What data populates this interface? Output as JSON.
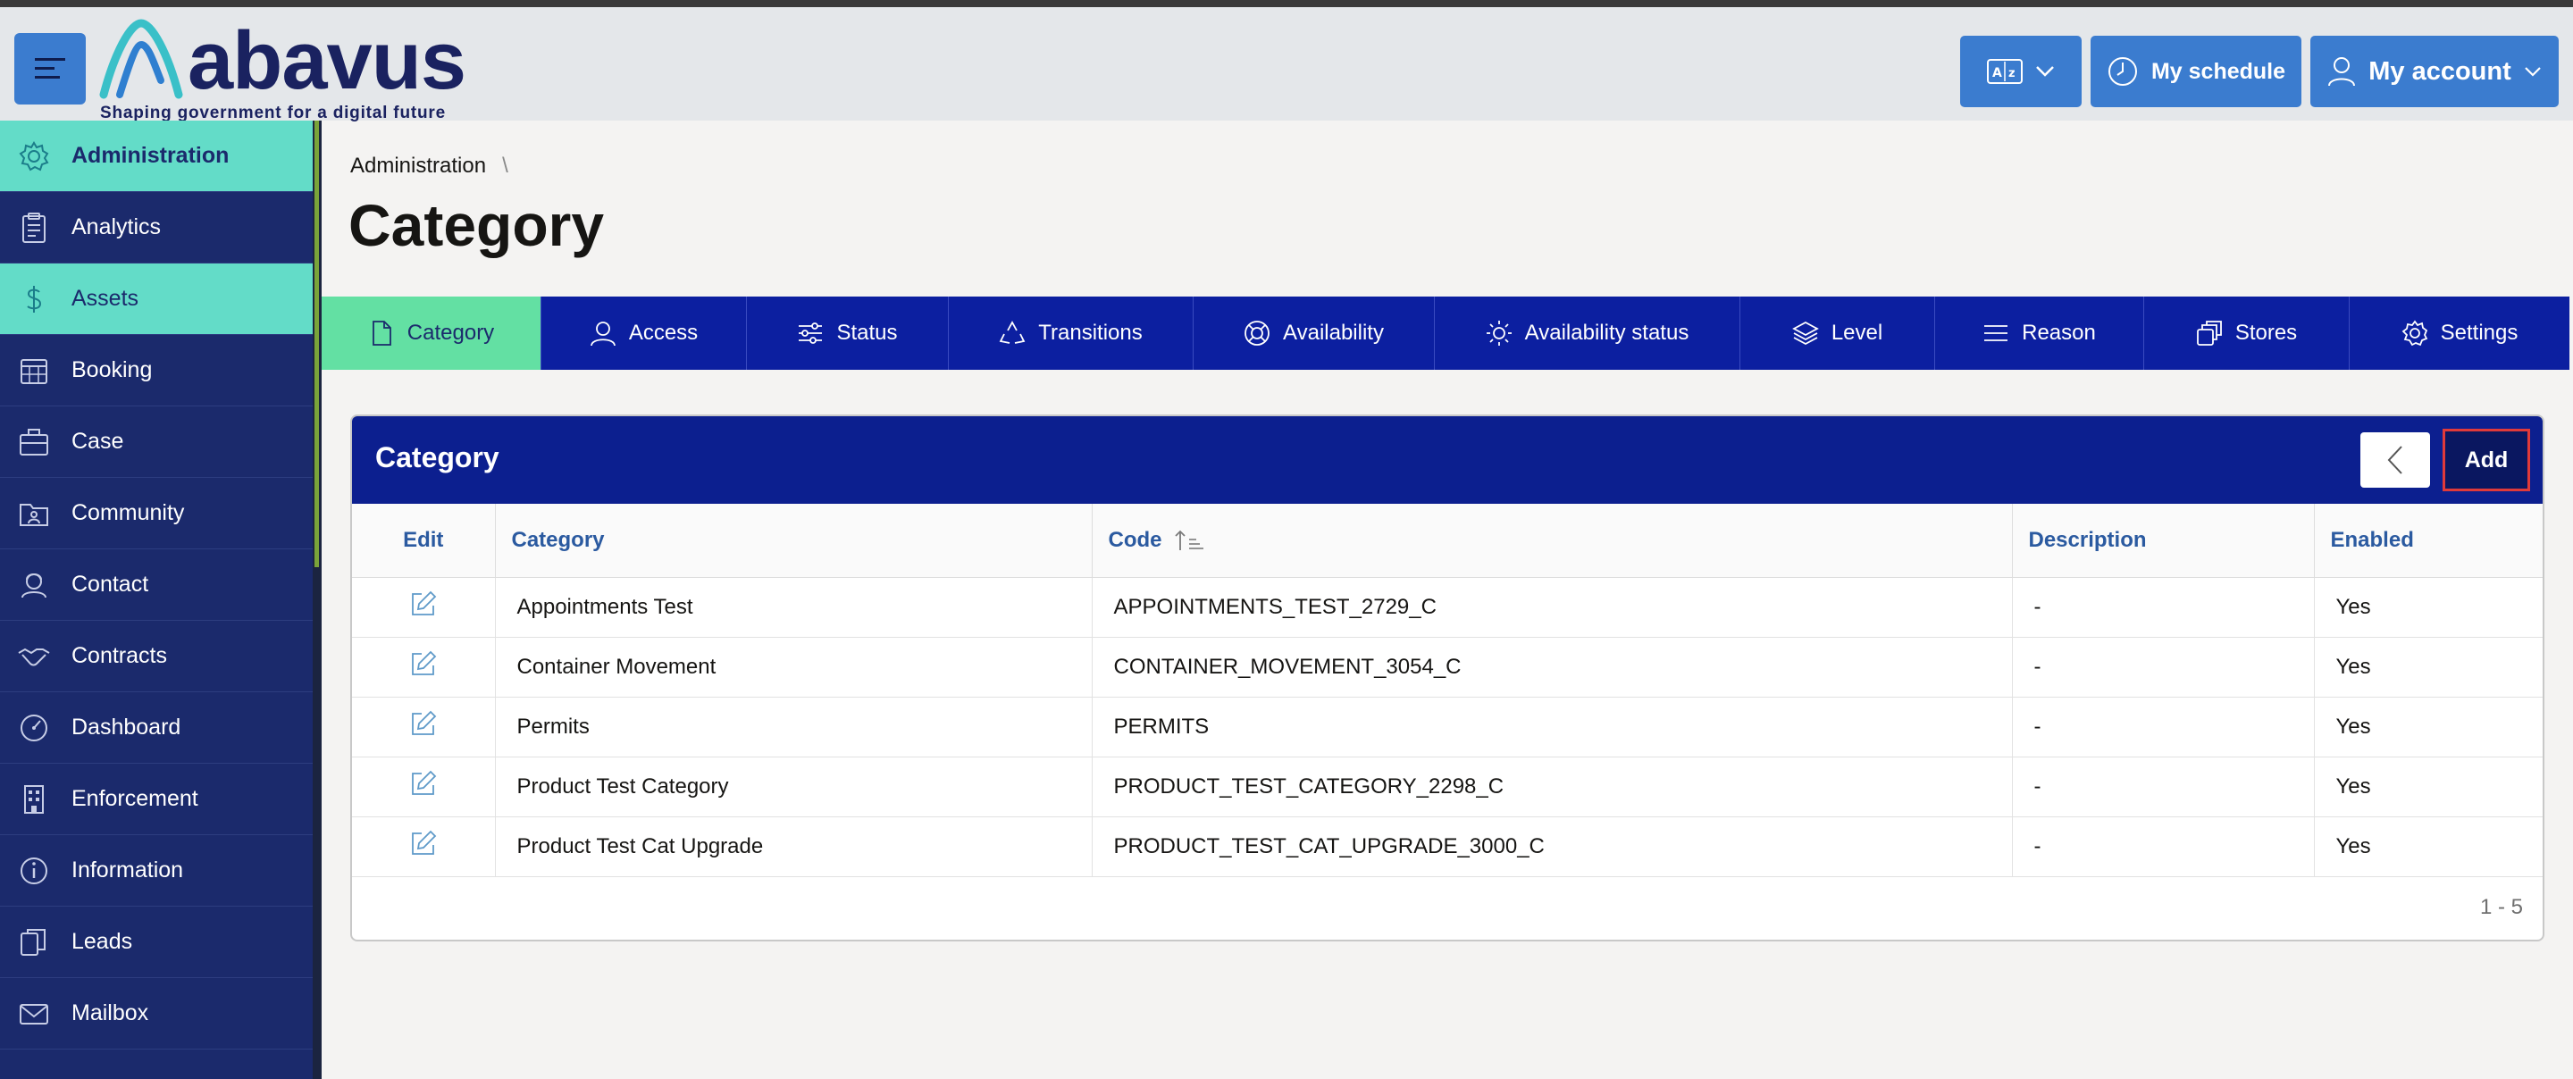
{
  "header": {
    "logo_text": "abavus",
    "logo_tagline": "Shaping government for a digital future",
    "schedule_label": "My schedule",
    "account_label": "My account",
    "colors": {
      "header_bg": "#e4e7ea",
      "button_bg": "#3b7ccf",
      "brand": "#1a2260"
    }
  },
  "sidebar": {
    "items": [
      {
        "label": "Administration",
        "icon": "gear-icon",
        "active": true
      },
      {
        "label": "Analytics",
        "icon": "clipboard-icon",
        "active": false
      },
      {
        "label": "Assets",
        "icon": "dollar-icon",
        "active": true
      },
      {
        "label": "Booking",
        "icon": "calendar-icon",
        "active": false
      },
      {
        "label": "Case",
        "icon": "briefcase-icon",
        "active": false
      },
      {
        "label": "Community",
        "icon": "folder-user-icon",
        "active": false
      },
      {
        "label": "Contact",
        "icon": "contact-icon",
        "active": false
      },
      {
        "label": "Contracts",
        "icon": "handshake-icon",
        "active": false
      },
      {
        "label": "Dashboard",
        "icon": "gauge-icon",
        "active": false
      },
      {
        "label": "Enforcement",
        "icon": "building-icon",
        "active": false
      },
      {
        "label": "Information",
        "icon": "info-icon",
        "active": false
      },
      {
        "label": "Leads",
        "icon": "copy-icon",
        "active": false
      },
      {
        "label": "Mailbox",
        "icon": "mail-icon",
        "active": false
      }
    ]
  },
  "breadcrumb": {
    "parent": "Administration",
    "separator": "\\"
  },
  "page_title": "Category",
  "tabs": [
    {
      "label": "Category",
      "icon": "file-icon",
      "active": true
    },
    {
      "label": "Access",
      "icon": "user-icon",
      "active": false
    },
    {
      "label": "Status",
      "icon": "sliders-icon",
      "active": false
    },
    {
      "label": "Transitions",
      "icon": "recycle-icon",
      "active": false
    },
    {
      "label": "Availability",
      "icon": "lifebuoy-icon",
      "active": false
    },
    {
      "label": "Availability status",
      "icon": "sun-icon",
      "active": false
    },
    {
      "label": "Level",
      "icon": "layers-icon",
      "active": false
    },
    {
      "label": "Reason",
      "icon": "list-icon",
      "active": false
    },
    {
      "label": "Stores",
      "icon": "stores-icon",
      "active": false
    },
    {
      "label": "Settings",
      "icon": "gear-icon",
      "active": false
    }
  ],
  "card": {
    "title": "Category",
    "add_label": "Add",
    "columns": {
      "edit": "Edit",
      "category": "Category",
      "code": "Code",
      "description": "Description",
      "enabled": "Enabled"
    },
    "rows": [
      {
        "category": "Appointments Test",
        "code": "APPOINTMENTS_TEST_2729_C",
        "description": "-",
        "enabled": "Yes"
      },
      {
        "category": "Container Movement",
        "code": "CONTAINER_MOVEMENT_3054_C",
        "description": "-",
        "enabled": "Yes"
      },
      {
        "category": "Permits",
        "code": "PERMITS",
        "description": "-",
        "enabled": "Yes"
      },
      {
        "category": "Product Test Category",
        "code": "PRODUCT_TEST_CATEGORY_2298_C",
        "description": "-",
        "enabled": "Yes"
      },
      {
        "category": "Product Test Cat Upgrade",
        "code": "PRODUCT_TEST_CAT_UPGRADE_3000_C",
        "description": "-",
        "enabled": "Yes"
      }
    ],
    "pagination": "1 - 5"
  }
}
